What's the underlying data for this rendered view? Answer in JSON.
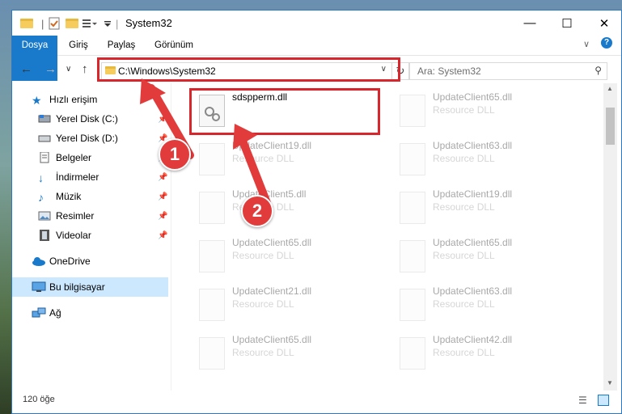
{
  "window": {
    "title": "System32"
  },
  "ribbon": {
    "tabs": [
      {
        "label": "Dosya"
      },
      {
        "label": "Giriş"
      },
      {
        "label": "Paylaş"
      },
      {
        "label": "Görünüm"
      }
    ]
  },
  "address": {
    "path": "C:\\Windows\\System32"
  },
  "search": {
    "placeholder": "Ara: System32"
  },
  "sidebar": {
    "items": [
      {
        "label": "Hızlı erişim"
      },
      {
        "label": "Yerel Disk (C:)"
      },
      {
        "label": "Yerel Disk (D:)"
      },
      {
        "label": "Belgeler"
      },
      {
        "label": "İndirmeler"
      },
      {
        "label": "Müzik"
      },
      {
        "label": "Resimler"
      },
      {
        "label": "Videolar"
      },
      {
        "label": "OneDrive"
      },
      {
        "label": "Bu bilgisayar"
      },
      {
        "label": "Ağ"
      }
    ]
  },
  "files": [
    {
      "name": "sdspperm.dll",
      "type": ""
    },
    {
      "name": "UpdateClient65.dll",
      "type": "Resource DLL"
    },
    {
      "name": "UpdateClient19.dll",
      "type": "Resource DLL"
    },
    {
      "name": "UpdateClient63.dll",
      "type": "Resource DLL"
    },
    {
      "name": "UpdateClient5.dll",
      "type": "Resource DLL"
    },
    {
      "name": "UpdateClient19.dll",
      "type": "Resource DLL"
    },
    {
      "name": "UpdateClient65.dll",
      "type": "Resource DLL"
    },
    {
      "name": "UpdateClient65.dll",
      "type": "Resource DLL"
    },
    {
      "name": "UpdateClient21.dll",
      "type": "Resource DLL"
    },
    {
      "name": "UpdateClient63.dll",
      "type": "Resource DLL"
    },
    {
      "name": "UpdateClient65.dll",
      "type": "Resource DLL"
    },
    {
      "name": "UpdateClient42.dll",
      "type": "Resource DLL"
    }
  ],
  "status": {
    "count": "120 öğe"
  },
  "annotations": {
    "badge1": "1",
    "badge2": "2"
  },
  "colors": {
    "accent": "#1979ca",
    "highlight": "#d9262c",
    "selected": "#cce8ff"
  }
}
